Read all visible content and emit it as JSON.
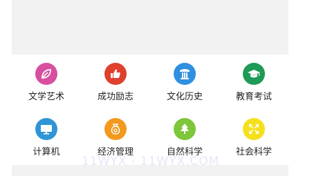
{
  "categories": [
    {
      "label": "文学艺术",
      "icon": "leaf-icon",
      "color": "#d84fa0"
    },
    {
      "label": "成功励志",
      "icon": "thumbs-up-icon",
      "color": "#e0402e"
    },
    {
      "label": "文化历史",
      "icon": "column-icon",
      "color": "#2f8fe0"
    },
    {
      "label": "教育考试",
      "icon": "graduation-cap-icon",
      "color": "#1f9a57"
    },
    {
      "label": "计算机",
      "icon": "monitor-icon",
      "color": "#2f95d6"
    },
    {
      "label": "经济管理",
      "icon": "money-bag-icon",
      "color": "#f19a1e"
    },
    {
      "label": "自然科学",
      "icon": "tree-icon",
      "color": "#7ec63a"
    },
    {
      "label": "社会科学",
      "icon": "expand-arrows-icon",
      "color": "#f5e01c"
    }
  ],
  "watermark": "11WYX · 11WYX.COM"
}
